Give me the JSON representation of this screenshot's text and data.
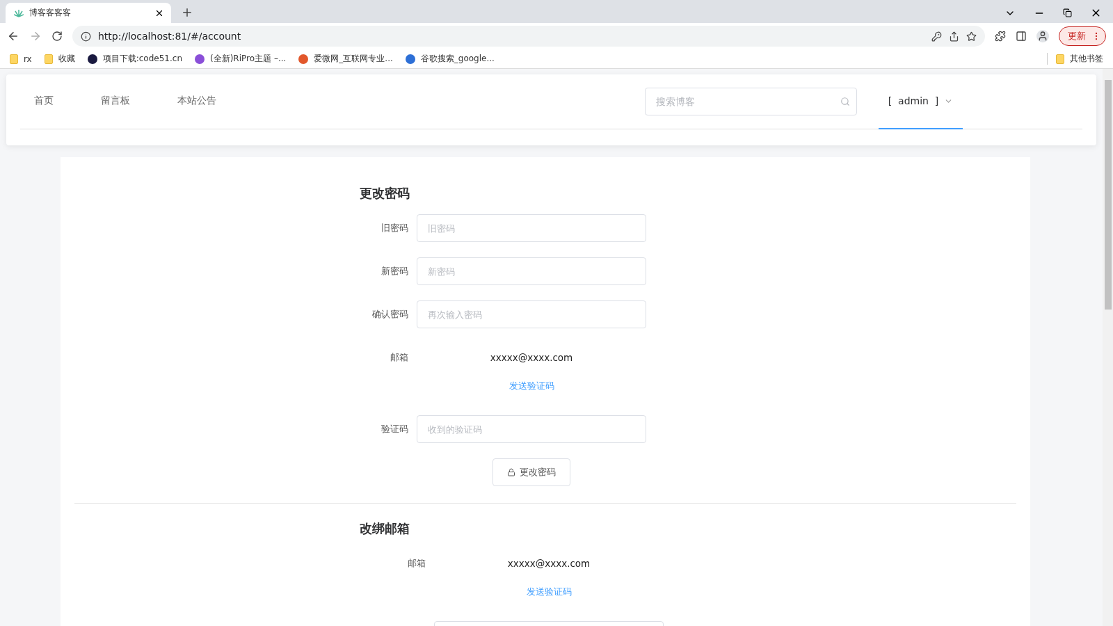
{
  "browser": {
    "tab_title": "博客客客客",
    "url": "http://localhost:81/#/account",
    "update_button": "更新",
    "bookmarks": [
      {
        "kind": "folder",
        "label": "rx"
      },
      {
        "kind": "folder",
        "label": "收藏"
      },
      {
        "kind": "site",
        "label": "项目下载:code51.cn",
        "color": "#1a1a40"
      },
      {
        "kind": "site",
        "label": "(全新)RiPro主题 –...",
        "color": "#8a4fd8"
      },
      {
        "kind": "site",
        "label": "爱微网_互联网专业...",
        "color": "#e2572b"
      },
      {
        "kind": "site",
        "label": "谷歌搜索_google...",
        "color": "#2d6fd6"
      }
    ],
    "other_bookmarks": "其他书签"
  },
  "nav": {
    "items": [
      {
        "label": "首页",
        "selected": false
      },
      {
        "label": "留言板",
        "selected": false
      },
      {
        "label": "本站公告",
        "selected": false
      }
    ],
    "search": {
      "placeholder": "搜索博客"
    },
    "user_menu": {
      "label": "[  admin  ]",
      "selected": true
    }
  },
  "change_password": {
    "title": "更改密码",
    "rows": [
      {
        "kind": "input",
        "label": "旧密码",
        "placeholder": "旧密码"
      },
      {
        "kind": "input",
        "label": "新密码",
        "placeholder": "新密码"
      },
      {
        "kind": "input",
        "label": "确认密码",
        "placeholder": "再次输入密码"
      },
      {
        "kind": "text",
        "label": "邮箱",
        "value": "xxxxx@xxxx.com"
      },
      {
        "kind": "link",
        "link": "发送验证码"
      },
      {
        "kind": "input",
        "label": "验证码",
        "placeholder": "收到的验证码"
      }
    ],
    "submit": "更改密码"
  },
  "change_email": {
    "title": "改绑邮箱",
    "rows": [
      {
        "kind": "text",
        "label": "邮箱",
        "value": "xxxxx@xxxx.com"
      },
      {
        "kind": "link",
        "link": "发送验证码"
      },
      {
        "kind": "input"
      }
    ]
  }
}
